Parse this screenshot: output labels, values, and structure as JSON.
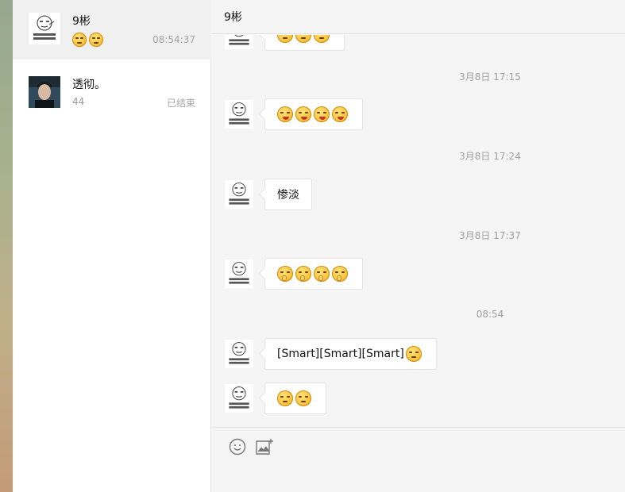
{
  "sidebar": {
    "conversations": [
      {
        "name": "9彬",
        "preview_emojis": [
          "pensive",
          "pensive"
        ],
        "time": "08:54:37",
        "active": true
      },
      {
        "name": "透彻。",
        "preview": "44",
        "time": "已结束",
        "active": false
      }
    ]
  },
  "chat": {
    "title": "9彬",
    "timestamps": [
      "3月8日 17:15",
      "3月8日 17:24",
      "3月8日 17:37",
      "08:54"
    ],
    "messages": [
      {
        "type": "emoji",
        "emojis": [
          "laugh",
          "laugh",
          "laugh"
        ],
        "partial": true
      },
      {
        "type": "emoji",
        "emojis": [
          "tongue",
          "tongue",
          "tongue",
          "tongue"
        ]
      },
      {
        "type": "text",
        "text": "惨淡"
      },
      {
        "type": "emoji",
        "emojis": [
          "shush",
          "shush",
          "shush",
          "shush"
        ]
      },
      {
        "type": "text",
        "text": "[Smart][Smart][Smart]",
        "trailing_emoji": "pensive"
      },
      {
        "type": "emoji",
        "emojis": [
          "pensive",
          "pensive"
        ]
      }
    ]
  },
  "composer": {
    "tools": [
      "emoji-icon",
      "image-icon"
    ]
  },
  "colors": {
    "sidebar_bg": "#ffffff",
    "active_item_bg": "#f0f0f0",
    "chat_bg": "#f5f5f5",
    "bubble_bg": "#ffffff",
    "muted_text": "#a5a5a5"
  }
}
